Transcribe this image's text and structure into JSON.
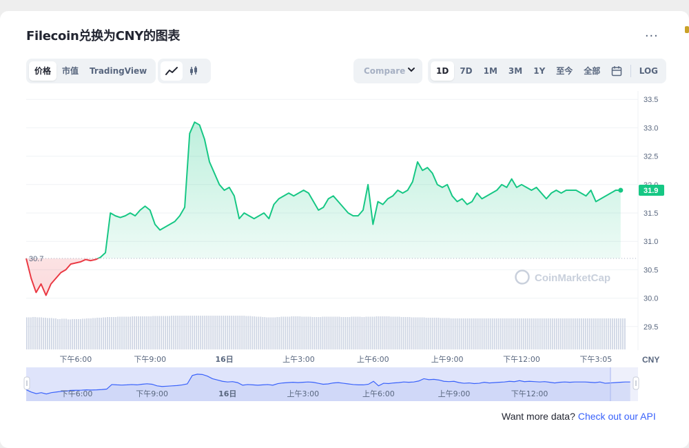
{
  "title": "Filecoin兑换为CNY的图表",
  "more_label": "...",
  "tabs": {
    "price": "价格",
    "market_cap": "市值",
    "tradingview": "TradingView"
  },
  "chart_type_icons": [
    "line-chart-icon",
    "candlestick-icon"
  ],
  "compare": {
    "placeholder": "Compare with"
  },
  "ranges": [
    "1D",
    "7D",
    "1M",
    "3M",
    "1Y",
    "至今",
    "全部"
  ],
  "active_range": "1D",
  "log_label": "LOG",
  "footer": {
    "text": "Want more data?",
    "link": "Check out our API"
  },
  "watermark": "CoinMarketCap",
  "colors": {
    "up": "#16c784",
    "down": "#ea3943",
    "accent": "#3861fb"
  },
  "chart_data": {
    "type": "line",
    "currency": "CNY",
    "open_price": 30.7,
    "current_price": 31.9,
    "current_price_label": "31.9",
    "open_price_label": "30.7",
    "ylim": [
      29.4,
      33.6
    ],
    "y_ticks": [
      "33.5",
      "33.0",
      "32.5",
      "32.0",
      "31.5",
      "31.0",
      "30.5",
      "30.0",
      "29.5"
    ],
    "x_tick_labels": [
      "下午6:00",
      "下午9:00",
      "16日",
      "上午3:00",
      "上午6:00",
      "上午9:00",
      "下午12:00",
      "下午3:05"
    ],
    "x_ticks": [
      2,
      5,
      8,
      11,
      14,
      17,
      20,
      23
    ],
    "navigator_labels": [
      "下午6:00",
      "下午9:00",
      "16日",
      "上午3:00",
      "上午6:00",
      "上午9:00",
      "下午12:00"
    ],
    "xlim": [
      0,
      24.2
    ],
    "x": [
      0,
      0.2,
      0.4,
      0.6,
      0.8,
      1.0,
      1.2,
      1.4,
      1.6,
      1.8,
      2.0,
      2.2,
      2.4,
      2.6,
      2.8,
      3.0,
      3.2,
      3.4,
      3.6,
      3.8,
      4.0,
      4.2,
      4.4,
      4.6,
      4.8,
      5.0,
      5.2,
      5.4,
      5.6,
      5.8,
      6.0,
      6.2,
      6.4,
      6.6,
      6.8,
      7.0,
      7.2,
      7.4,
      7.6,
      7.8,
      8.0,
      8.2,
      8.4,
      8.6,
      8.8,
      9.0,
      9.2,
      9.4,
      9.6,
      9.8,
      10.0,
      10.2,
      10.4,
      10.6,
      10.8,
      11.0,
      11.2,
      11.4,
      11.6,
      11.8,
      12.0,
      12.2,
      12.4,
      12.6,
      12.8,
      13.0,
      13.2,
      13.4,
      13.6,
      13.8,
      14.0,
      14.2,
      14.4,
      14.6,
      14.8,
      15.0,
      15.2,
      15.4,
      15.6,
      15.8,
      16.0,
      16.2,
      16.4,
      16.6,
      16.8,
      17.0,
      17.2,
      17.4,
      17.6,
      17.8,
      18.0,
      18.2,
      18.4,
      18.6,
      18.8,
      19.0,
      19.2,
      19.4,
      19.6,
      19.8,
      20.0,
      20.2,
      20.4,
      20.6,
      20.8,
      21.0,
      21.2,
      21.4,
      21.6,
      21.8,
      22.0,
      22.2,
      22.4,
      22.6,
      22.8,
      23.0,
      23.2,
      23.4,
      23.6,
      23.8,
      24.0
    ],
    "prices": [
      30.7,
      30.35,
      30.1,
      30.25,
      30.05,
      30.25,
      30.35,
      30.45,
      30.5,
      30.6,
      30.62,
      30.64,
      30.68,
      30.66,
      30.68,
      30.72,
      30.8,
      31.5,
      31.45,
      31.42,
      31.45,
      31.5,
      31.45,
      31.55,
      31.62,
      31.55,
      31.3,
      31.2,
      31.25,
      31.3,
      31.35,
      31.45,
      31.6,
      32.9,
      33.1,
      33.05,
      32.8,
      32.4,
      32.2,
      32.0,
      31.9,
      31.95,
      31.8,
      31.4,
      31.5,
      31.45,
      31.4,
      31.45,
      31.5,
      31.4,
      31.65,
      31.75,
      31.8,
      31.85,
      31.8,
      31.85,
      31.9,
      31.85,
      31.7,
      31.55,
      31.6,
      31.75,
      31.8,
      31.7,
      31.6,
      31.5,
      31.45,
      31.45,
      31.55,
      32.0,
      31.3,
      31.7,
      31.65,
      31.75,
      31.8,
      31.9,
      31.85,
      31.9,
      32.05,
      32.4,
      32.25,
      32.3,
      32.2,
      32.0,
      31.95,
      32.0,
      31.8,
      31.7,
      31.75,
      31.65,
      31.7,
      31.85,
      31.75,
      31.8,
      31.85,
      31.9,
      32.0,
      31.95,
      32.1,
      31.95,
      32.0,
      31.95,
      31.9,
      31.95,
      31.85,
      31.75,
      31.85,
      31.9,
      31.85,
      31.9,
      31.9,
      31.9,
      31.85,
      31.8,
      31.9,
      31.7,
      31.75,
      31.8,
      31.85,
      31.9,
      31.9
    ],
    "volume_max": 1,
    "volumes": [
      0.95,
      0.96,
      0.95,
      0.94,
      0.93,
      0.92,
      0.9,
      0.91,
      0.89,
      0.9,
      0.9,
      0.91,
      0.92,
      0.93,
      0.94,
      0.95,
      0.96,
      0.96,
      0.97,
      0.97,
      0.97,
      0.98,
      0.98,
      0.98,
      0.98,
      0.99,
      0.99,
      0.99,
      0.99,
      1.0,
      1.0,
      1.0,
      1.0,
      1.0,
      1.0,
      1.0,
      1.0,
      1.0,
      1.0,
      1.0,
      1.0,
      1.0,
      1.0,
      1.0,
      0.99,
      0.98,
      0.97,
      0.96,
      0.95,
      0.95,
      0.96,
      0.97,
      0.97,
      0.98,
      0.98,
      0.97,
      0.97,
      0.96,
      0.96,
      0.97,
      0.97,
      0.97,
      0.97,
      0.96,
      0.96,
      0.97,
      0.97,
      0.96,
      0.97,
      0.97,
      0.98,
      0.98,
      0.98,
      0.97,
      0.97,
      0.96,
      0.96,
      0.95,
      0.95,
      0.95,
      0.94,
      0.94,
      0.94,
      0.93,
      0.93,
      0.92,
      0.92,
      0.92,
      0.92,
      0.92,
      0.92,
      0.92,
      0.92,
      0.92,
      0.92,
      0.92,
      0.92,
      0.92,
      0.92,
      0.92,
      0.92,
      0.92,
      0.92,
      0.92,
      0.92,
      0.92,
      0.92,
      0.92,
      0.92,
      0.92,
      0.92,
      0.92,
      0.92,
      0.92,
      0.92,
      0.92,
      0.92,
      0.92,
      0.92,
      0.92,
      0.92
    ]
  }
}
